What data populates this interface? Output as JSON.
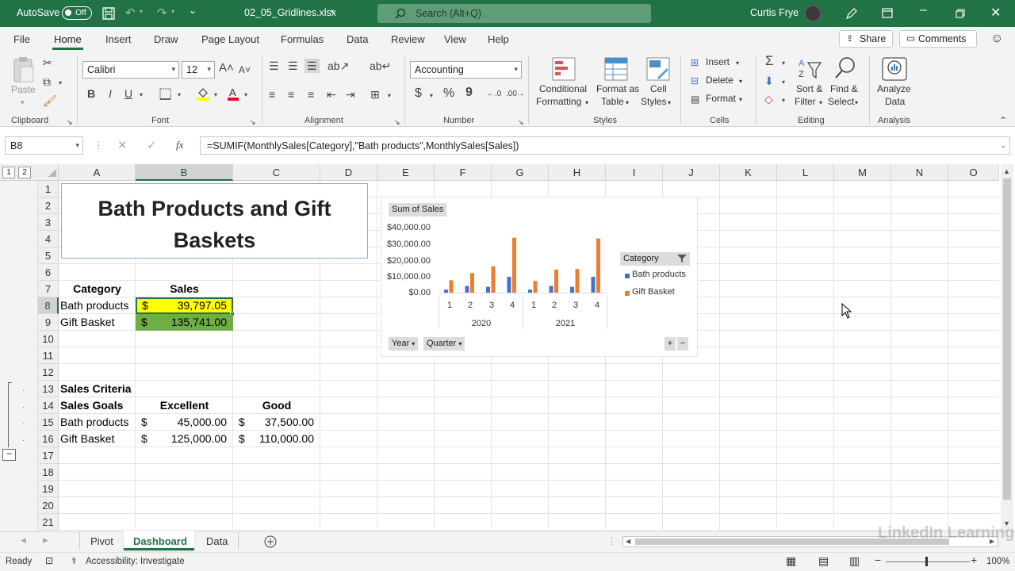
{
  "titlebar": {
    "autosave_label": "AutoSave",
    "autosave_state": "Off",
    "filename": "02_05_Gridlines.xlsx",
    "search_placeholder": "Search (Alt+Q)",
    "user_name": "Curtis Frye"
  },
  "menu": {
    "tabs": [
      "File",
      "Home",
      "Insert",
      "Draw",
      "Page Layout",
      "Formulas",
      "Data",
      "Review",
      "View",
      "Help"
    ],
    "active_tab": "Home",
    "share_label": "Share",
    "comments_label": "Comments"
  },
  "ribbon": {
    "clipboard": {
      "paste": "Paste",
      "label": "Clipboard"
    },
    "font": {
      "name": "Calibri",
      "size": "12",
      "label": "Font",
      "bold": "B",
      "italic": "I",
      "underline": "U"
    },
    "alignment": {
      "label": "Alignment"
    },
    "number": {
      "format": "Accounting",
      "label": "Number",
      "currency": "$",
      "percent": "%",
      "comma": "9"
    },
    "styles": {
      "conditional_1": "Conditional",
      "conditional_2": "Formatting",
      "format_as_1": "Format as",
      "format_as_2": "Table",
      "cell_styles_1": "Cell",
      "cell_styles_2": "Styles",
      "label": "Styles"
    },
    "cells": {
      "insert": "Insert",
      "delete": "Delete",
      "format": "Format",
      "label": "Cells"
    },
    "editing": {
      "sort_1": "Sort &",
      "sort_2": "Filter",
      "find_1": "Find &",
      "find_2": "Select",
      "label": "Editing"
    },
    "analysis": {
      "analyze_1": "Analyze",
      "analyze_2": "Data",
      "label": "Analysis"
    }
  },
  "formula_bar": {
    "name_box": "B8",
    "fx": "fx",
    "formula": "=SUMIF(MonthlySales[Category],\"Bath products\",MonthlySales[Sales])"
  },
  "grid": {
    "columns": [
      "A",
      "B",
      "C",
      "D",
      "E",
      "F",
      "G",
      "H",
      "I",
      "J",
      "K",
      "L",
      "M",
      "N",
      "O"
    ],
    "rows": [
      "1",
      "2",
      "3",
      "4",
      "5",
      "6",
      "7",
      "8",
      "9",
      "10",
      "11",
      "12",
      "13",
      "14",
      "15",
      "16",
      "17",
      "18",
      "19",
      "20",
      "21"
    ],
    "outline_levels": [
      "1",
      "2"
    ],
    "title_line1": "Bath Products and Gift",
    "title_line2": "Baskets",
    "a7": "Category",
    "b7": "Sales",
    "a8": "Bath products",
    "b8_currency": "$",
    "b8_value": "39,797.05",
    "a9": "Gift Basket",
    "b9_currency": "$",
    "b9_value": "135,741.00",
    "a13": "Sales Criteria",
    "a14": "Sales Goals",
    "b14": "Excellent",
    "c14": "Good",
    "a15": "Bath products",
    "b15_currency": "$",
    "b15_value": "45,000.00",
    "c15_currency": "$",
    "c15_value": "37,500.00",
    "a16": "Gift Basket",
    "b16_currency": "$",
    "b16_value": "125,000.00",
    "c16_currency": "$",
    "c16_value": "110,000.00"
  },
  "chart_data": {
    "type": "bar",
    "title": "Sum of Sales",
    "categories": [
      "1",
      "2",
      "3",
      "4",
      "1",
      "2",
      "3",
      "4"
    ],
    "groups": [
      "2020",
      "2021"
    ],
    "series": [
      {
        "name": "Bath products",
        "values": [
          1800,
          4000,
          3500,
          9500,
          1800,
          4000,
          3500,
          9500
        ],
        "color": "#4472c4"
      },
      {
        "name": "Gift Basket",
        "values": [
          7500,
          11800,
          15800,
          33000,
          7000,
          13800,
          14200,
          32500
        ],
        "color": "#ed7d31"
      }
    ],
    "yticks": [
      "$40,000.00",
      "$30,000.00",
      "$20,000.00",
      "$10,000.00",
      "$0.00"
    ],
    "ylim": [
      0,
      40000
    ],
    "legend_title": "Category",
    "axis_buttons": [
      "Year",
      "Quarter"
    ],
    "legend_position": "right",
    "grid": false
  },
  "sheets": {
    "tabs": [
      "Pivot",
      "Dashboard",
      "Data"
    ],
    "active": "Dashboard"
  },
  "status": {
    "ready": "Ready",
    "accessibility": "Accessibility: Investigate",
    "zoom": "100%",
    "watermark": "LinkedIn Learning"
  }
}
